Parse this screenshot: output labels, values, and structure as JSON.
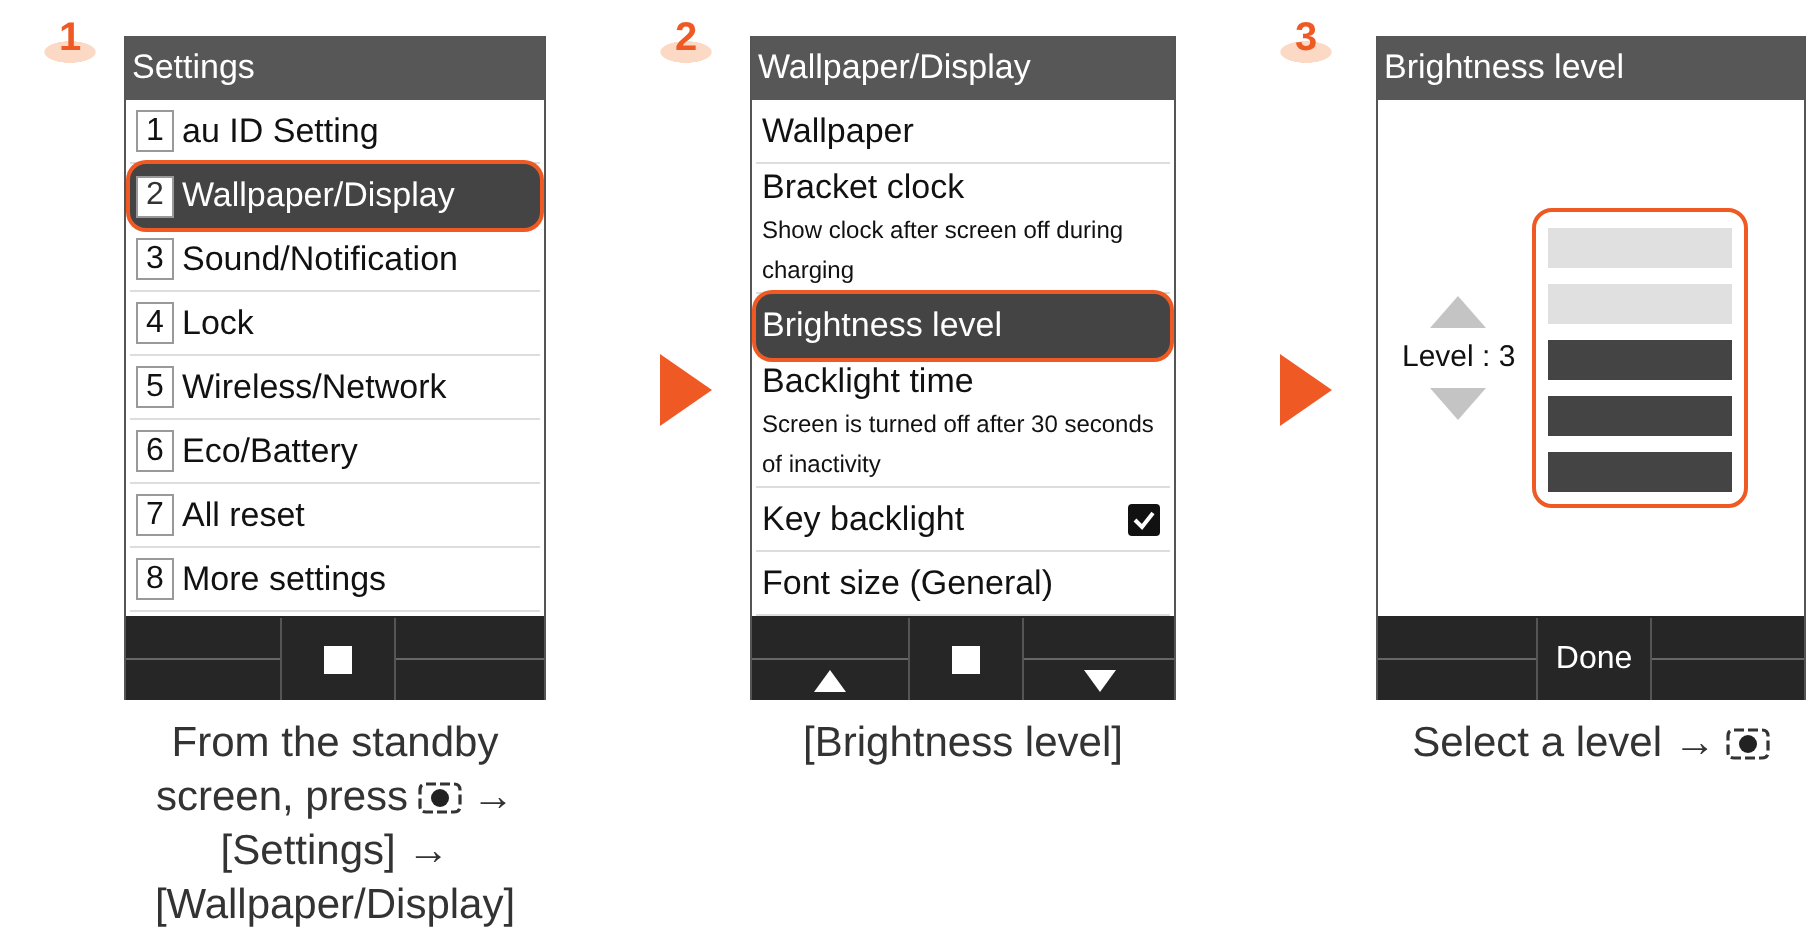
{
  "steps": [
    {
      "number": "1",
      "screen": {
        "title": "Settings",
        "kind": "numbered_list",
        "items": [
          {
            "number": "1",
            "label": "au ID Setting",
            "selected": false
          },
          {
            "number": "2",
            "label": "Wallpaper/Display",
            "selected": true
          },
          {
            "number": "3",
            "label": "Sound/Notification",
            "selected": false
          },
          {
            "number": "4",
            "label": "Lock",
            "selected": false
          },
          {
            "number": "5",
            "label": "Wireless/Network",
            "selected": false
          },
          {
            "number": "6",
            "label": "Eco/Battery",
            "selected": false
          },
          {
            "number": "7",
            "label": "All reset",
            "selected": false
          },
          {
            "number": "8",
            "label": "More settings",
            "selected": false
          }
        ],
        "softkeys": [
          {
            "kind": "blank"
          },
          {
            "kind": "square"
          },
          {
            "kind": "blank"
          }
        ]
      },
      "caption": [
        [
          {
            "kind": "text",
            "text": "From the standby"
          }
        ],
        [
          {
            "kind": "text",
            "text": "screen, press"
          },
          {
            "kind": "key"
          },
          {
            "kind": "text",
            "text": "→"
          }
        ],
        [
          {
            "kind": "text",
            "text": "[Settings] →"
          }
        ],
        [
          {
            "kind": "text",
            "text": "[Wallpaper/Display]"
          }
        ]
      ]
    },
    {
      "number": "2",
      "screen": {
        "title": "Wallpaper/Display",
        "kind": "menu",
        "items": [
          {
            "kind": "plain",
            "label": "Wallpaper",
            "selected": false
          },
          {
            "kind": "sub",
            "label": "Bracket clock",
            "sub": "Show clock after screen off during charging",
            "selected": false
          },
          {
            "kind": "plain",
            "label": "Brightness level",
            "selected": true
          },
          {
            "kind": "sub",
            "label": "Backlight time",
            "sub": "Screen is turned off after 30 seconds of inactivity",
            "selected": false
          },
          {
            "kind": "checkbox",
            "label": "Key backlight",
            "checked": true,
            "selected": false
          },
          {
            "kind": "plain",
            "label": "Font size (General)",
            "selected": false
          }
        ],
        "softkeys": [
          {
            "kind": "up"
          },
          {
            "kind": "square"
          },
          {
            "kind": "down"
          }
        ]
      },
      "caption": [
        [
          {
            "kind": "text",
            "text": "[Brightness level]"
          }
        ]
      ]
    },
    {
      "number": "3",
      "screen": {
        "title": "Brightness level",
        "kind": "level",
        "reading": "Level : 3",
        "level": 0.6,
        "softkeys": [
          {
            "kind": "blank"
          },
          {
            "kind": "text",
            "text": "Done"
          },
          {
            "kind": "blank"
          }
        ]
      },
      "caption": [
        [
          {
            "kind": "text",
            "text": "Select a level →"
          },
          {
            "kind": "key"
          }
        ]
      ]
    }
  ]
}
